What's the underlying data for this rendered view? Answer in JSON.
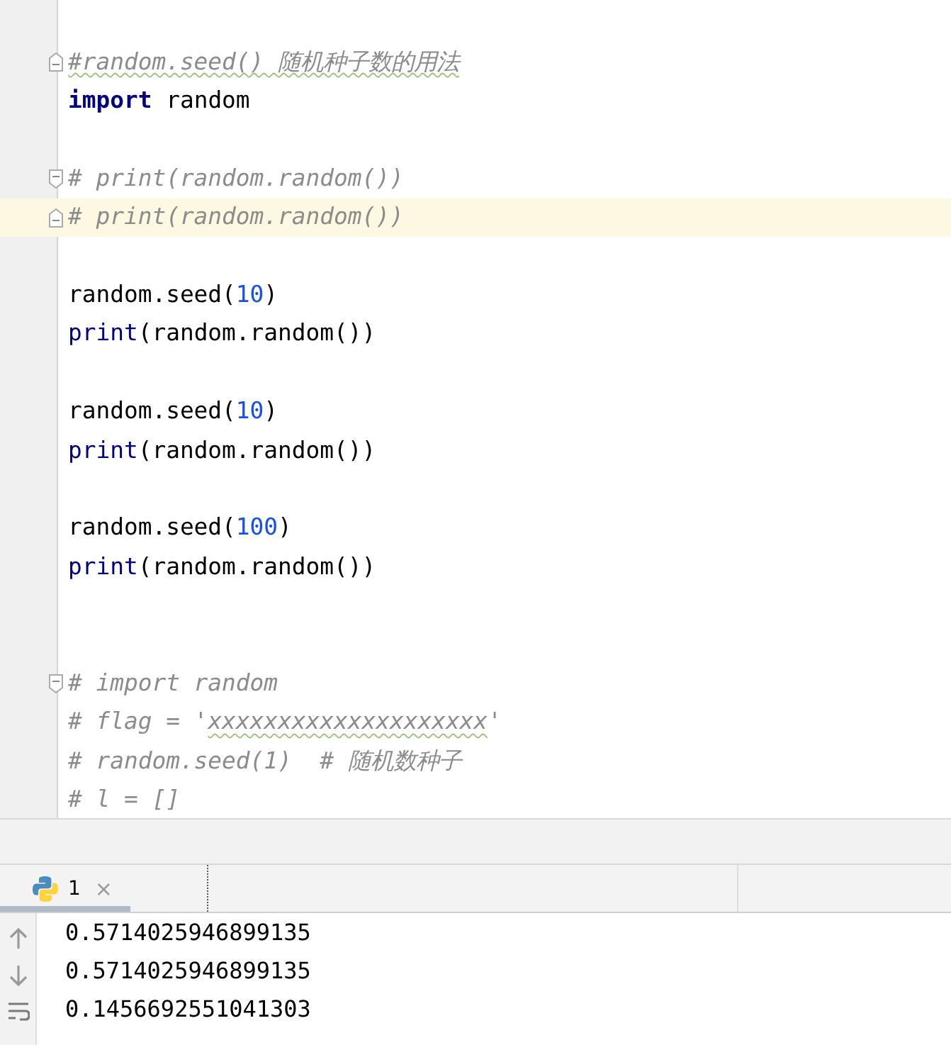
{
  "editor": {
    "lines": [
      {
        "kind": "code",
        "fold_start": true,
        "fold_end": false,
        "current": false,
        "tokens": [
          {
            "kind": "comment",
            "text": "#random.seed() 随机种子数的用法",
            "squiggle": true
          }
        ]
      },
      {
        "kind": "code",
        "fold_start": false,
        "fold_end": false,
        "current": false,
        "tokens": [
          {
            "kind": "keyword",
            "text": "import",
            "squiggle": false
          },
          {
            "kind": "plain",
            "text": " random",
            "squiggle": false
          }
        ]
      },
      {
        "kind": "blank"
      },
      {
        "kind": "code",
        "fold_start": false,
        "fold_end": true,
        "current": false,
        "tokens": [
          {
            "kind": "comment",
            "text": "# print(random.random())",
            "squiggle": false
          }
        ]
      },
      {
        "kind": "code",
        "fold_start": true,
        "fold_end": false,
        "current": true,
        "tokens": [
          {
            "kind": "comment",
            "text": "# print(random.random())",
            "squiggle": false
          }
        ]
      },
      {
        "kind": "blank"
      },
      {
        "kind": "code",
        "fold_start": false,
        "fold_end": false,
        "current": false,
        "tokens": [
          {
            "kind": "plain",
            "text": "random.seed(",
            "squiggle": false
          },
          {
            "kind": "number",
            "text": "10",
            "squiggle": false
          },
          {
            "kind": "plain",
            "text": ")",
            "squiggle": false
          }
        ]
      },
      {
        "kind": "code",
        "fold_start": false,
        "fold_end": false,
        "current": false,
        "tokens": [
          {
            "kind": "builtin",
            "text": "print",
            "squiggle": false
          },
          {
            "kind": "plain",
            "text": "(random.random())",
            "squiggle": false
          }
        ]
      },
      {
        "kind": "blank"
      },
      {
        "kind": "code",
        "fold_start": false,
        "fold_end": false,
        "current": false,
        "tokens": [
          {
            "kind": "plain",
            "text": "random.seed(",
            "squiggle": false
          },
          {
            "kind": "number",
            "text": "10",
            "squiggle": false
          },
          {
            "kind": "plain",
            "text": ")",
            "squiggle": false
          }
        ]
      },
      {
        "kind": "code",
        "fold_start": false,
        "fold_end": false,
        "current": false,
        "tokens": [
          {
            "kind": "builtin",
            "text": "print",
            "squiggle": false
          },
          {
            "kind": "plain",
            "text": "(random.random())",
            "squiggle": false
          }
        ]
      },
      {
        "kind": "blank"
      },
      {
        "kind": "code",
        "fold_start": false,
        "fold_end": false,
        "current": false,
        "tokens": [
          {
            "kind": "plain",
            "text": "random.seed(",
            "squiggle": false
          },
          {
            "kind": "number",
            "text": "100",
            "squiggle": false
          },
          {
            "kind": "plain",
            "text": ")",
            "squiggle": false
          }
        ]
      },
      {
        "kind": "code",
        "fold_start": false,
        "fold_end": false,
        "current": false,
        "tokens": [
          {
            "kind": "builtin",
            "text": "print",
            "squiggle": false
          },
          {
            "kind": "plain",
            "text": "(random.random())",
            "squiggle": false
          }
        ]
      },
      {
        "kind": "blank"
      },
      {
        "kind": "blank"
      },
      {
        "kind": "code",
        "fold_start": false,
        "fold_end": true,
        "current": false,
        "tokens": [
          {
            "kind": "comment",
            "text": "# import random",
            "squiggle": false
          }
        ]
      },
      {
        "kind": "code",
        "fold_start": false,
        "fold_end": false,
        "current": false,
        "tokens": [
          {
            "kind": "comment",
            "text": "# flag = '",
            "squiggle": false
          },
          {
            "kind": "comment",
            "text": "xxxxxxxxxxxxxxxxxxxx",
            "squiggle": true
          },
          {
            "kind": "comment",
            "text": "'",
            "squiggle": false
          }
        ]
      },
      {
        "kind": "code",
        "fold_start": false,
        "fold_end": false,
        "current": false,
        "tokens": [
          {
            "kind": "comment",
            "text": "# random.seed(1)  # 随机数种子",
            "squiggle": false
          }
        ]
      },
      {
        "kind": "code",
        "fold_start": false,
        "fold_end": false,
        "current": false,
        "tokens": [
          {
            "kind": "comment",
            "text": "# l = []",
            "squiggle": false
          }
        ]
      }
    ]
  },
  "run_panel": {
    "tabs": [
      {
        "label": "1",
        "selected": true,
        "close": "×"
      }
    ],
    "output": [
      "0.5714025946899135",
      "0.5714025946899135",
      "0.1456692551041303"
    ]
  }
}
